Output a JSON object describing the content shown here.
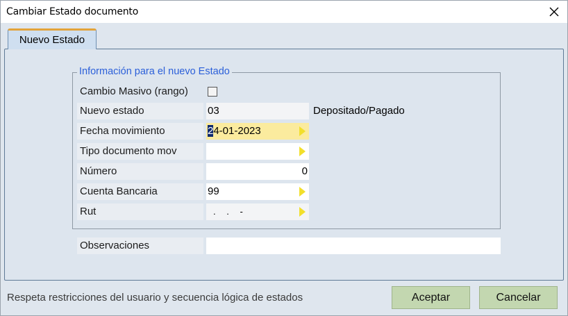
{
  "window": {
    "title": "Cambiar Estado documento",
    "close_icon": "close-icon"
  },
  "tab": {
    "label": "Nuevo Estado"
  },
  "group": {
    "legend": "Información para el nuevo Estado"
  },
  "fields": {
    "cambio_masivo": {
      "label": "Cambio Masivo (rango)",
      "checked": false
    },
    "nuevo_estado": {
      "label": "Nuevo estado",
      "value": "03",
      "description": "Depositado/Pagado"
    },
    "fecha_movimiento": {
      "label": "Fecha movimiento",
      "value_first_char": "2",
      "value_rest": "4-01-2023"
    },
    "tipo_documento": {
      "label": "Tipo documento mov",
      "value": ""
    },
    "numero": {
      "label": "Número",
      "value": "0"
    },
    "cuenta_bancaria": {
      "label": "Cuenta Bancaria",
      "value": "99"
    },
    "rut": {
      "label": "Rut",
      "value": ". . -"
    },
    "observaciones": {
      "label": "Observaciones",
      "value": ""
    }
  },
  "status_bar": {
    "text": "Respeta restricciones del usuario y secuencia lógica de estados"
  },
  "buttons": {
    "aceptar": "Aceptar",
    "cancelar": "Cancelar"
  },
  "colors": {
    "accent_tab_border": "#e3a33a",
    "legend": "#2b5fd9",
    "active_field": "#fbeb9e",
    "lov_arrow": "#f2df2c",
    "button": "#c3d7b0"
  }
}
